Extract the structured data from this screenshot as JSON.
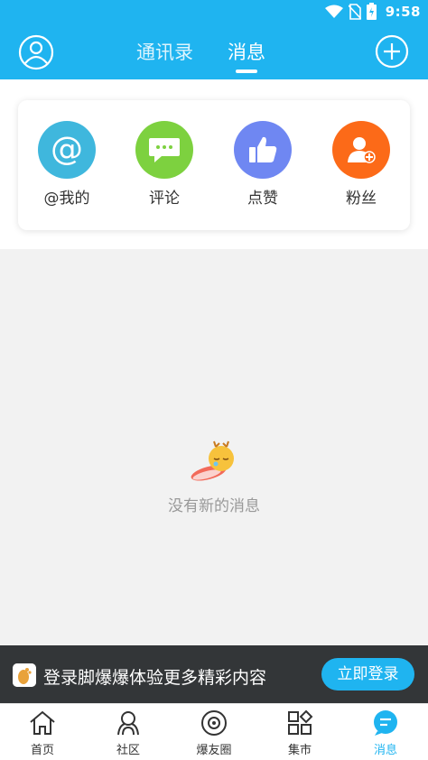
{
  "status_bar": {
    "time": "9:58",
    "icons": [
      "wifi-icon",
      "no-sim-icon",
      "battery-icon"
    ]
  },
  "header": {
    "tabs": [
      {
        "label": "通讯录",
        "active": false
      },
      {
        "label": "消息",
        "active": true
      }
    ],
    "icons": {
      "left": "avatar-icon",
      "right": "add-icon"
    }
  },
  "categories": [
    {
      "label": "@我的",
      "icon": "at-icon",
      "color": "#3fb7dd"
    },
    {
      "label": "评论",
      "icon": "comment-icon",
      "color": "#7dd13f"
    },
    {
      "label": "点赞",
      "icon": "thumbs-up-icon",
      "color": "#6f87f2"
    },
    {
      "label": "粉丝",
      "icon": "fans-icon",
      "color": "#fc6a18"
    }
  ],
  "empty_state": {
    "text": "没有新的消息",
    "icon": "sleeping-mascot-icon"
  },
  "login_banner": {
    "text": "登录脚爆爆体验更多精彩内容",
    "button": "立即登录"
  },
  "bottom_nav": [
    {
      "label": "首页",
      "icon": "home-icon",
      "active": false
    },
    {
      "label": "社区",
      "icon": "community-icon",
      "active": false
    },
    {
      "label": "爆友圈",
      "icon": "circle-icon",
      "active": false
    },
    {
      "label": "集市",
      "icon": "market-icon",
      "active": false
    },
    {
      "label": "消息",
      "icon": "message-icon",
      "active": true
    }
  ],
  "colors": {
    "primary": "#1fb4f0",
    "banner_bg": "#333638",
    "page_bg": "#f2f2f2"
  }
}
